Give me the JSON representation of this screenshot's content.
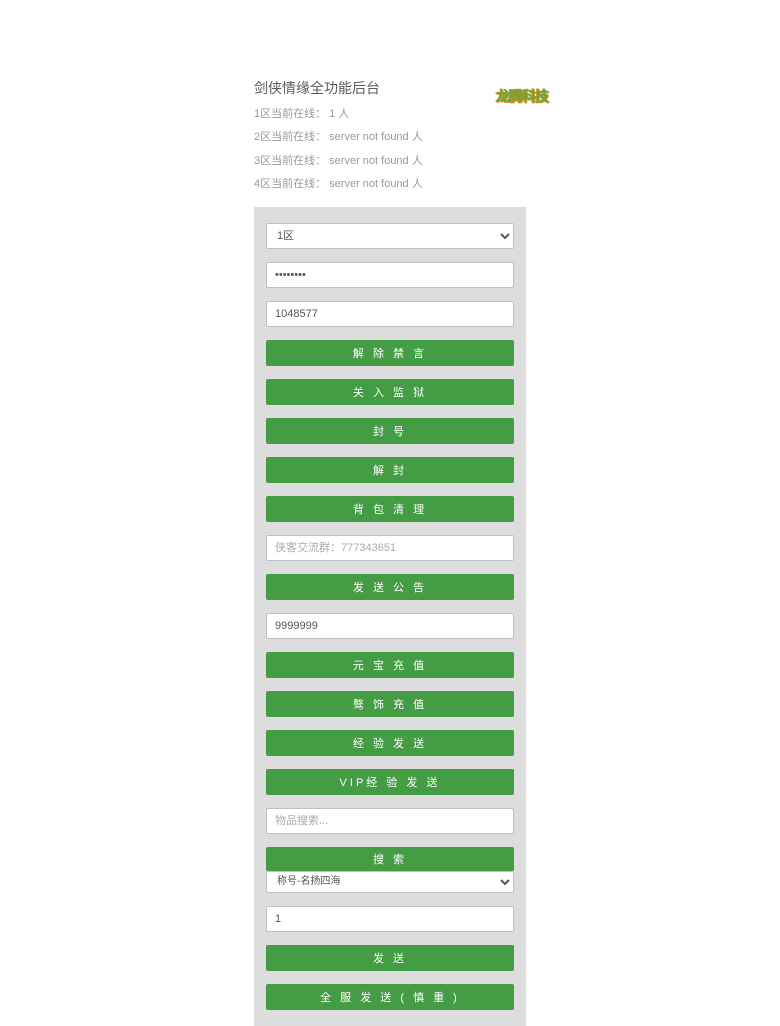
{
  "header": {
    "title": "剑侠情缘全功能后台",
    "logo_text": "龙腾科技",
    "status": [
      {
        "zone": "1区当前在线： 1 人"
      },
      {
        "zone": "2区当前在线： server not found 人"
      },
      {
        "zone": "3区当前在线： server not found 人"
      },
      {
        "zone": "4区当前在线： server not found 人"
      }
    ]
  },
  "zone_select": {
    "options": [
      "1区"
    ]
  },
  "inputs": {
    "password_value": "••••••••",
    "account_value": "1048577",
    "msg_placeholder": "侠客交流群：777343651",
    "amount_value": "9999999",
    "item_search_placeholder": "物品搜索...",
    "quantity_value": "1"
  },
  "item_select": {
    "options": [
      "称号-名扬四海"
    ]
  },
  "buttons": {
    "unban": "解 除 禁 言",
    "jail": "关 入 监 狱",
    "ban": "封 号",
    "unseal": "解 封",
    "clear_bag": "背 包 清 理",
    "send_notice": "发 送 公 告",
    "recharge_yuanbao": "元 宝 充 值",
    "recharge_zhuangshi": "骜 饰 充 值",
    "send_exp": "经 验 发 送",
    "send_vip_exp": "VIP经 验 发 送",
    "search": "搜 索",
    "send": "发 送",
    "send_all": "全 服 发 送 ( 慎 重 )"
  }
}
